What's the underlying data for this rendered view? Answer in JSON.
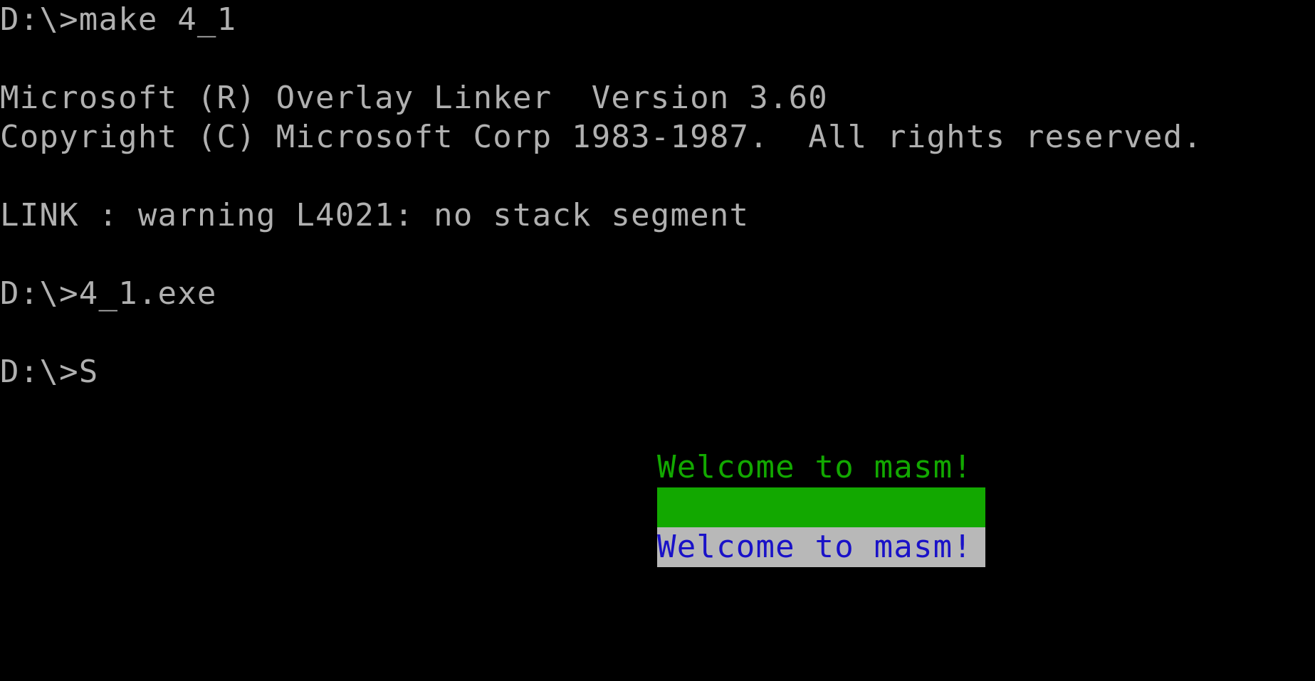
{
  "terminal": {
    "screen_bg": "#000000",
    "text_color": "#b0b0b0",
    "lines": [
      {
        "text": "D:\\>make 4_1",
        "kind": "command"
      },
      {
        "text": " ",
        "kind": "blank"
      },
      {
        "text": "Microsoft (R) Overlay Linker  Version 3.60",
        "kind": "output"
      },
      {
        "text": "Copyright (C) Microsoft Corp 1983-1987.  All rights reserved.",
        "kind": "output"
      },
      {
        "text": " ",
        "kind": "blank"
      },
      {
        "text": "LINK : warning L4021: no stack segment",
        "kind": "output"
      },
      {
        "text": " ",
        "kind": "blank"
      },
      {
        "text": "D:\\>4_1.exe",
        "kind": "command"
      },
      {
        "text": " ",
        "kind": "blank"
      },
      {
        "text": "D:\\>S",
        "kind": "prompt-with-input"
      }
    ]
  },
  "program_output": {
    "rows": [
      {
        "text": "Welcome to masm!",
        "fg": "#12a800",
        "bg": "#000000",
        "style": "green-on-black"
      },
      {
        "text": "                ",
        "fg": "#12a800",
        "bg": "#12a800",
        "style": "green-bar"
      },
      {
        "text": "Welcome to masm!",
        "fg": "#1a12c8",
        "bg": "#b8b8b8",
        "style": "blue-on-gray"
      }
    ]
  }
}
